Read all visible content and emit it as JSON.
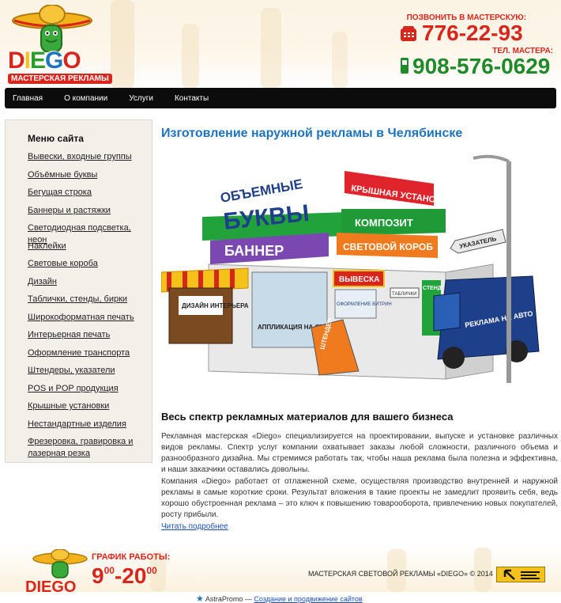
{
  "header": {
    "logo_text": "DIEGO",
    "logo_letters": [
      "D",
      "I",
      "E",
      "G",
      "O"
    ],
    "logo_colors": [
      "#d9261c",
      "#f5c21a",
      "#2a9d2a",
      "#1e73be",
      "#d9261c"
    ],
    "logo_subtitle": "МАСТЕРСКАЯ РЕКЛАМЫ",
    "call_label": "ПОЗВОНИТЬ В МАСТЕРСКУЮ:",
    "phone_main": "776-22-93",
    "master_label": "ТЕЛ. МАСТЕРА:",
    "phone_master": "908-576-0629",
    "phone_main_color": "#d9261c",
    "phone_master_color": "#1f8a2a"
  },
  "nav": {
    "items": [
      "Главная",
      "О компании",
      "Услуги",
      "Контакты"
    ]
  },
  "sidebar": {
    "title": "Меню сайта",
    "items": [
      "Вывески, входные группы",
      "Объёмные буквы",
      "Бегущая строка",
      "Баннеры и растяжки",
      "Светодиодная подсветка, неон",
      "Наклейки",
      "Световые короба",
      "Дизайн",
      "Таблички, стенды, бирки",
      "Широкоформатная печать",
      "Интерьерная печать",
      "Оформление транспорта",
      "Штендеры, указатели",
      "POS и POP продукция",
      "Крышные установки",
      "Нестандартные изделия",
      "Фрезеровка, гравировка и лазерная резка"
    ]
  },
  "content": {
    "title": "Изготовление наружной рекламы в Челябинске",
    "illustration_labels": {
      "roof": "КРЫШНАЯ УСТАНОВКА",
      "letters_top": "ОБЪЕМНЫЕ",
      "letters_bottom": "БУКВЫ",
      "composite": "КОМПОЗИТ",
      "banner": "БАННЕР",
      "lightbox": "СВЕТОВОЙ КОРОБ",
      "pointer": "УКАЗАТЕЛЬ",
      "design": "ДИЗАЙН ИНТЕРЬЕРА",
      "glass": "АППЛИКАЦИЯ НА СТЕКЛО",
      "sign": "ВЫВЕСКА",
      "windows": "ОФОРМЛЕНИЕ ВИТРИН",
      "plates": "ТАБЛИЧКИ",
      "stand": "СТЕНД",
      "shtender": "ШТЕНДЕР",
      "van": "РЕКЛАМА НА АВТО"
    },
    "subtitle": "Весь спектр рекламных материалов для вашего бизнеса",
    "paragraph1": "Рекламная мастерская «Diego» специализируется на проектировании, выпуске и установке различных видов рекламы. Спектр услуг компании охватывает заказы любой сложности, различного объема и разнообразного дизайна. Мы стремимся работать так, чтобы наша реклама была полезна и эффективна, и наши заказчики оставались довольны.",
    "paragraph2": "Компания «Diego» работает от отлаженной схеме, осуществляя производство внутренней и наружной рекламы в самые короткие сроки. Результат вложения в такие проекты не замедлит проявить себя, ведь хорошо обустроенная реклама – это ключ к повышению товарооборота, привлечению новых покупателей, росту прибыли.",
    "read_more": "Читать подробнее"
  },
  "footer": {
    "schedule_label": "ГРАФИК РАБОТЫ:",
    "hour_start": "9",
    "min_start": "00",
    "hour_end": "20",
    "min_end": "00",
    "copyright": "МАСТЕРСКАЯ СВЕТОВОЙ РЕКЛАМЫ «DIEGO» © 2014",
    "credit_brand": "AstraPromo —",
    "credit_link": "Создание и продвижение сайтов"
  }
}
